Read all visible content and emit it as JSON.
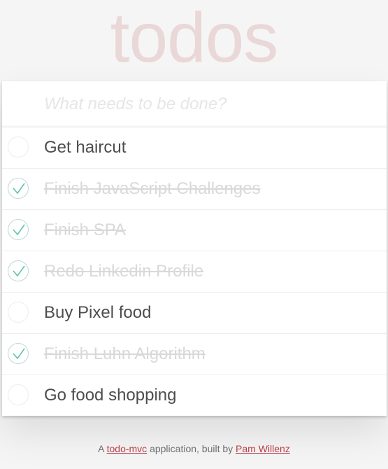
{
  "app": {
    "title": "todos"
  },
  "new_todo": {
    "placeholder": "What needs to be done?",
    "value": ""
  },
  "todos": [
    {
      "label": "Get haircut",
      "completed": false
    },
    {
      "label": "Finish JavaScript Challenges",
      "completed": true
    },
    {
      "label": "Finish SPA",
      "completed": true
    },
    {
      "label": "Redo Linkedin Profile",
      "completed": true
    },
    {
      "label": "Buy Pixel food",
      "completed": false
    },
    {
      "label": "Finish Luhn Algorithm",
      "completed": true
    },
    {
      "label": "Go food shopping",
      "completed": false
    }
  ],
  "footer": {
    "prefix": "A ",
    "link1": "todo-mvc",
    "middle": " application, built by ",
    "link2": "Pam Willenz"
  },
  "colors": {
    "title": "#efd5d5",
    "check": "#5dc2af",
    "completed_text": "#d9d9d9",
    "link": "#b83f45"
  },
  "icons": {
    "toggle_checked": "check-icon"
  }
}
